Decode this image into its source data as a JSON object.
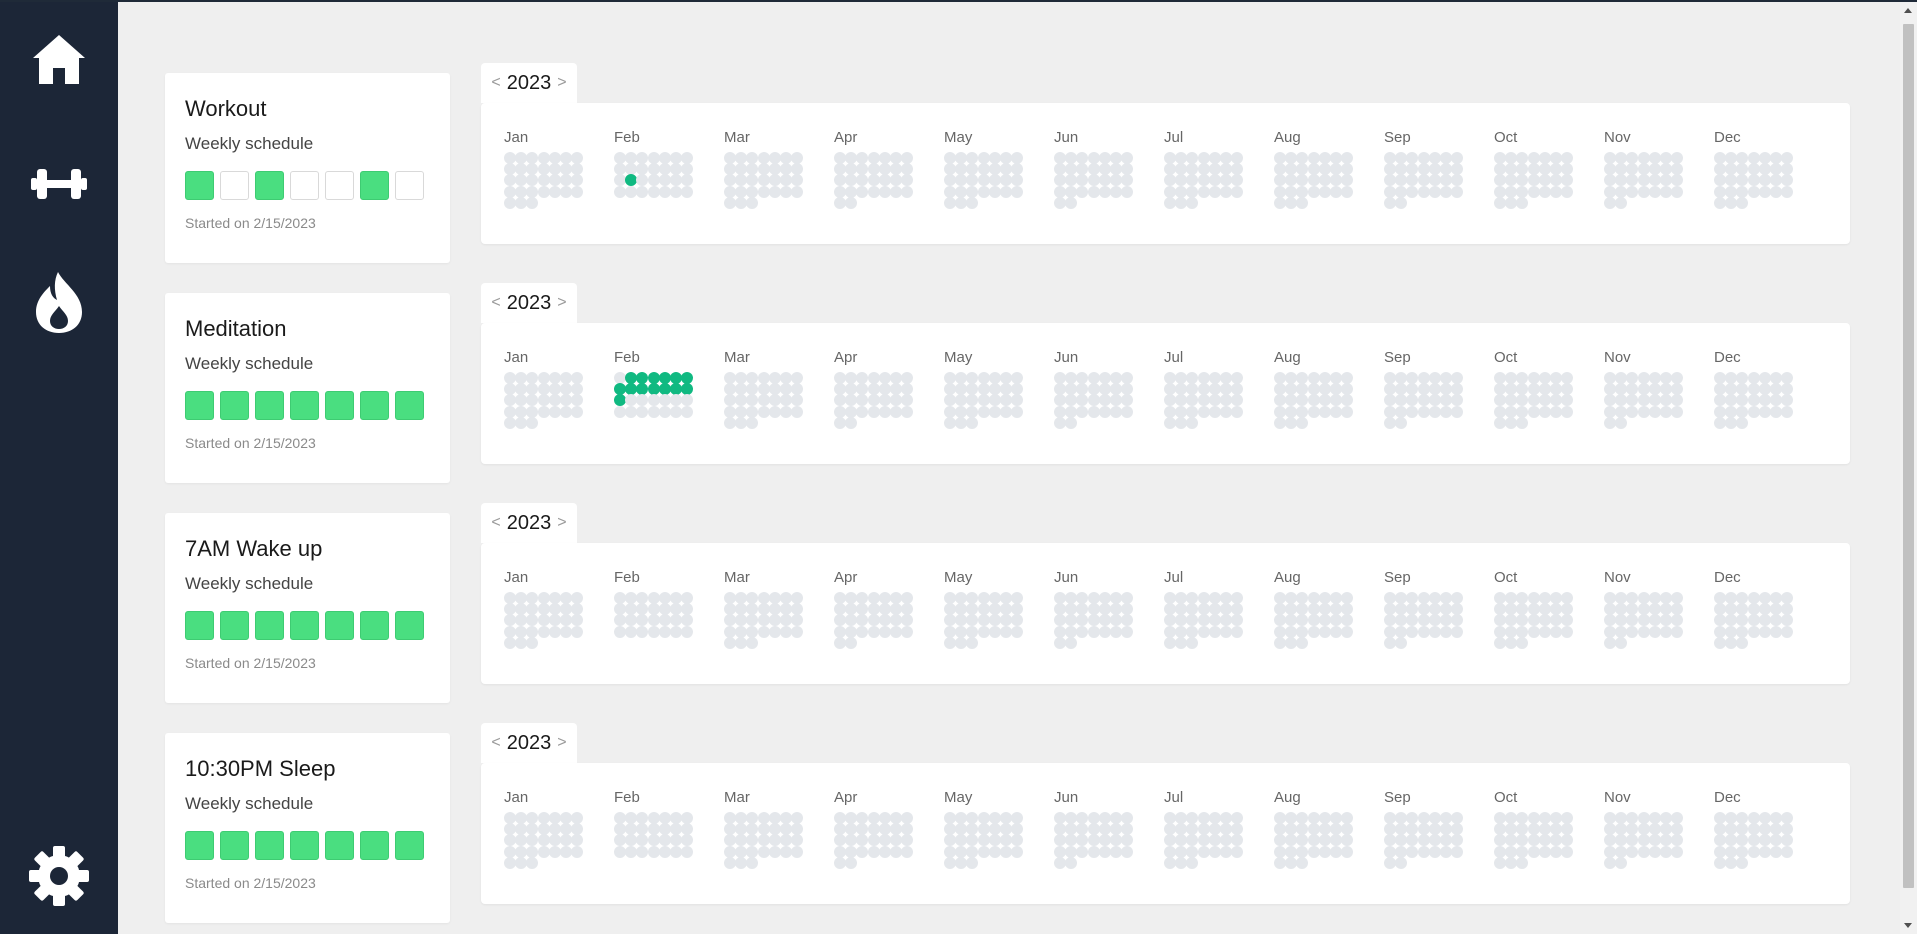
{
  "sidebar": {
    "items": [
      {
        "icon": "home-icon"
      },
      {
        "icon": "dumbbell-icon"
      },
      {
        "icon": "flame-icon"
      },
      {
        "icon": "gear-icon"
      }
    ]
  },
  "colors": {
    "sidebar_bg": "#1c2637",
    "page_bg": "#efefef",
    "week_day_on": "#4ade80",
    "calendar_dot_done": "#10b981",
    "calendar_dot_empty": "#e4e7eb"
  },
  "months": [
    "Jan",
    "Feb",
    "Mar",
    "Apr",
    "May",
    "Jun",
    "Jul",
    "Aug",
    "Sep",
    "Oct",
    "Nov",
    "Dec"
  ],
  "habits": [
    {
      "title": "Workout",
      "subtitle": "Weekly schedule",
      "week": [
        true,
        false,
        true,
        false,
        false,
        true,
        false
      ],
      "started": "Started on 2/15/2023",
      "year": "2023",
      "prev": "<",
      "next": ">",
      "completed_days": [
        46
      ]
    },
    {
      "title": "Meditation",
      "subtitle": "Weekly schedule",
      "week": [
        true,
        true,
        true,
        true,
        true,
        true,
        true
      ],
      "started": "Started on 2/15/2023",
      "year": "2023",
      "prev": "<",
      "next": ">",
      "completed_days": [
        32,
        33,
        34,
        35,
        36,
        37,
        38,
        39,
        40,
        41,
        42,
        43,
        44,
        45
      ]
    },
    {
      "title": "7AM Wake up",
      "subtitle": "Weekly schedule",
      "week": [
        true,
        true,
        true,
        true,
        true,
        true,
        true
      ],
      "started": "Started on 2/15/2023",
      "year": "2023",
      "prev": "<",
      "next": ">",
      "completed_days": []
    },
    {
      "title": "10:30PM Sleep",
      "subtitle": "Weekly schedule",
      "week": [
        true,
        true,
        true,
        true,
        true,
        true,
        true
      ],
      "started": "Started on 2/15/2023",
      "year": "2023",
      "prev": "<",
      "next": ">",
      "completed_days": []
    }
  ]
}
